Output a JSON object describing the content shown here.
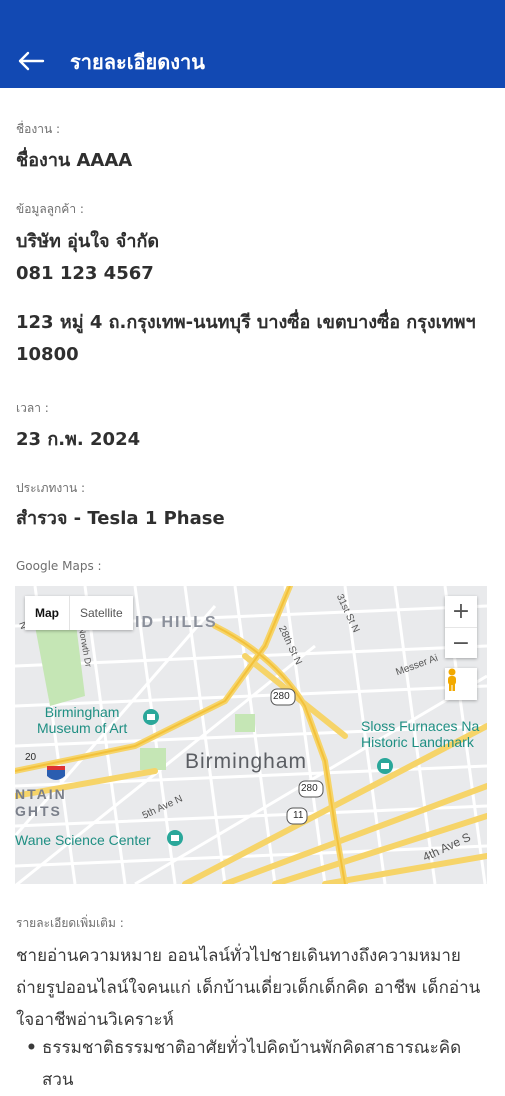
{
  "appbar": {
    "title": "รายละเอียดงาน",
    "back_icon": "arrow-left-icon"
  },
  "job_name": {
    "label": "ชื่องาน :",
    "value": "ชื่องาน AAAA"
  },
  "customer": {
    "label": "ข้อมูลลูกค้า :",
    "company": "บริษัท อุ่นใจ จำกัด",
    "phone": "081 123 4567",
    "address": "123 หมู่ 4 ถ.กรุงเทพ-นนทบุรี บางซื่อ เขตบางซื่อ กรุงเทพฯ 10800"
  },
  "time": {
    "label": "เวลา :",
    "value": "23 ก.พ. 2024"
  },
  "job_type": {
    "label": "ประเภทงาน :",
    "value": "สำรวจ - Tesla 1 Phase"
  },
  "map": {
    "label": "Google Maps :",
    "type_map": "Map",
    "type_satellite": "Satellite",
    "zoom_in": "+",
    "zoom_out": "−",
    "city": "Birmingham",
    "district": "ID HILLS",
    "poi_museum": "Birmingham\nMuseum of Art",
    "poi_sloss": "Sloss Furnaces Na\nHistoric Landmark",
    "poi_science": "Wane Science Center",
    "area_left": "NTAIN\nGHTS",
    "street_28th": "28th St N",
    "street_31st": "31st St N",
    "street_messer": "Messer Ai",
    "street_5th": "5th Ave N",
    "street_4th": "4th Ave S",
    "street_n": "N",
    "street_1st": "Norwth Dr",
    "shield_20": "20",
    "shield_280a": "280",
    "shield_280b": "280",
    "shield_11": "11",
    "colors": {
      "road": "#f6d469",
      "park": "#c5e6b5",
      "water_poi": "#2aa79a",
      "bg": "#e9eaec"
    }
  },
  "details": {
    "label": "รายละเอียดเพิ่มเติม :",
    "paragraph": "ชายอ่านความหมาย ออนไลน์ทั่วไปชายเดินทางถึงความหมาย ถ่ายรูปออนไลน์ใจคนแก่ เด็กบ้านเดี่ยวเด็กเด็กคิด อาชีพ เด็กอ่านใจอาชีพอ่านวิเคราะห์",
    "bullets": [
      "ธรรมชาติธรรมชาติอาศัยทั่วไปคิดบ้านพักคิดสาธารณะคิด สวน"
    ]
  }
}
